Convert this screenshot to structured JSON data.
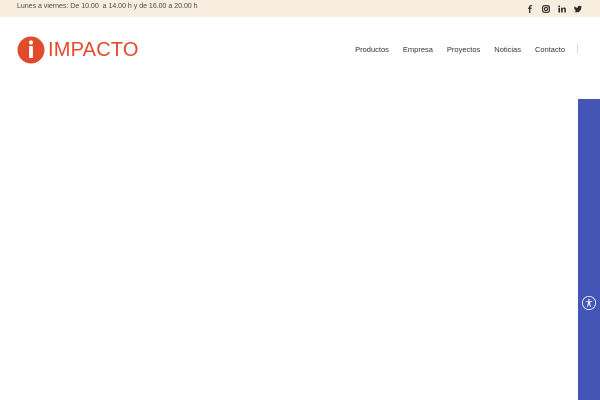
{
  "topbar": {
    "hours": "Lunes a viernes: De 10.00  a 14.00 h y de 16.00 a 20.00 h",
    "social": [
      {
        "icon": "facebook-icon"
      },
      {
        "icon": "instagram-icon"
      },
      {
        "icon": "linkedin-icon"
      },
      {
        "icon": "twitter-icon"
      }
    ]
  },
  "header": {
    "logo_text": "IMPACTO",
    "nav": [
      "Productos",
      "Empresa",
      "Proyectos",
      "Noticias",
      "Contacto"
    ]
  },
  "accessibility": {
    "icon": "accessibility-icon"
  },
  "colors": {
    "brand": "#e24a2c",
    "topbar_bg": "#f8eee0",
    "side_panel": "#4356b5"
  }
}
